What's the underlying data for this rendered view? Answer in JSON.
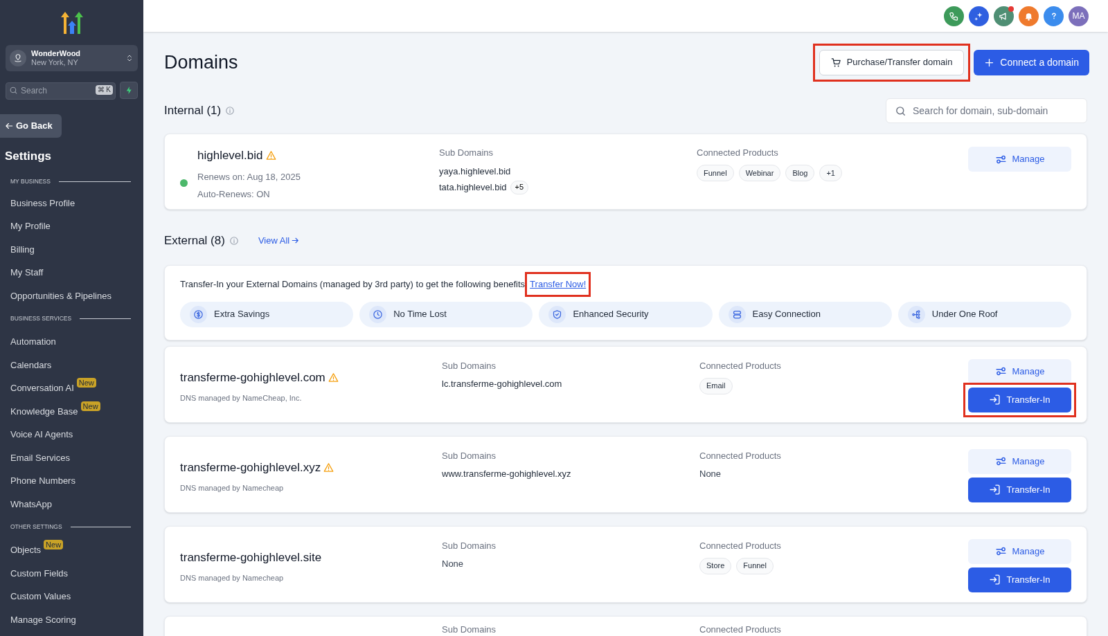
{
  "sidebar": {
    "account": {
      "name": "WonderWood",
      "location": "New York, NY"
    },
    "search": {
      "placeholder": "Search",
      "shortcut": "⌘ K"
    },
    "back": "Go Back",
    "title": "Settings",
    "sections": [
      {
        "label": "MY BUSINESS",
        "items": [
          {
            "label": "Business Profile"
          },
          {
            "label": "My Profile"
          },
          {
            "label": "Billing"
          },
          {
            "label": "My Staff"
          },
          {
            "label": "Opportunities & Pipelines"
          }
        ]
      },
      {
        "label": "BUSINESS SERVICES",
        "items": [
          {
            "label": "Automation"
          },
          {
            "label": "Calendars"
          },
          {
            "label": "Conversation AI",
            "badge": "New"
          },
          {
            "label": "Knowledge Base",
            "badge": "New"
          },
          {
            "label": "Voice AI Agents"
          },
          {
            "label": "Email Services"
          },
          {
            "label": "Phone Numbers"
          },
          {
            "label": "WhatsApp"
          }
        ]
      },
      {
        "label": "OTHER SETTINGS",
        "items": [
          {
            "label": "Objects",
            "badge": "New"
          },
          {
            "label": "Custom Fields"
          },
          {
            "label": "Custom Values"
          },
          {
            "label": "Manage Scoring"
          }
        ]
      }
    ]
  },
  "header": {
    "avatar": "MA",
    "notification_dot": true
  },
  "page": {
    "title": "Domains",
    "purchase_button": {
      "label": "Purchase/Transfer domain",
      "highlighted": true
    },
    "connect_button": {
      "label": "Connect a domain",
      "highlighted": false
    },
    "internal": {
      "heading": "Internal (1)",
      "search": {
        "placeholder": "Search for domain, sub-domain"
      },
      "domain": {
        "name": "highlevel.bid",
        "warning": true,
        "active": true,
        "renews": "Renews on: Aug 18, 2025",
        "auto_renew": "Auto-Renews: ON",
        "sub_label": "Sub Domains",
        "subs": [
          "yaya.highlevel.bid",
          "tata.highlevel.bid"
        ],
        "sub_more": "+5",
        "products_label": "Connected Products",
        "products": [
          "Funnel",
          "Webinar",
          "Blog",
          "+1"
        ],
        "manage": "Manage"
      }
    },
    "external": {
      "heading": "External (8)",
      "view_all": "View All",
      "banner": {
        "text": "Transfer-In your External Domains (managed by 3rd party) to get the following benefits",
        "link": {
          "label": "Transfer Now!",
          "highlighted": true
        },
        "benefits": [
          {
            "kind": "savings",
            "label": "Extra Savings"
          },
          {
            "kind": "time",
            "label": "No Time Lost"
          },
          {
            "kind": "security",
            "label": "Enhanced Security"
          },
          {
            "kind": "connection",
            "label": "Easy Connection"
          },
          {
            "kind": "roof",
            "label": "Under One Roof"
          }
        ]
      },
      "domains": [
        {
          "name": "transferme-gohighlevel.com",
          "warning": true,
          "dns": "DNS managed by NameCheap, Inc.",
          "sub_label": "Sub Domains",
          "subs": [
            "lc.transferme-gohighlevel.com"
          ],
          "products_label": "Connected Products",
          "products": [
            "Email"
          ],
          "manage": "Manage",
          "transfer": {
            "label": "Transfer-In",
            "highlighted": true
          }
        },
        {
          "name": "transferme-gohighlevel.xyz",
          "warning": true,
          "dns": "DNS managed by Namecheap",
          "sub_label": "Sub Domains",
          "subs": [
            "www.transferme-gohighlevel.xyz"
          ],
          "products_label": "Connected Products",
          "products_text": "None",
          "manage": "Manage",
          "transfer": {
            "label": "Transfer-In",
            "highlighted": false
          }
        },
        {
          "name": "transferme-gohighlevel.site",
          "warning": false,
          "dns": "DNS managed by Namecheap",
          "sub_label": "Sub Domains",
          "subs_text": "None",
          "products_label": "Connected Products",
          "products": [
            "Store",
            "Funnel"
          ],
          "manage": "Manage",
          "transfer": {
            "label": "Transfer-In",
            "highlighted": false
          }
        },
        {
          "sub_label": "Sub Domains",
          "products_label": "Connected Products"
        }
      ]
    }
  }
}
